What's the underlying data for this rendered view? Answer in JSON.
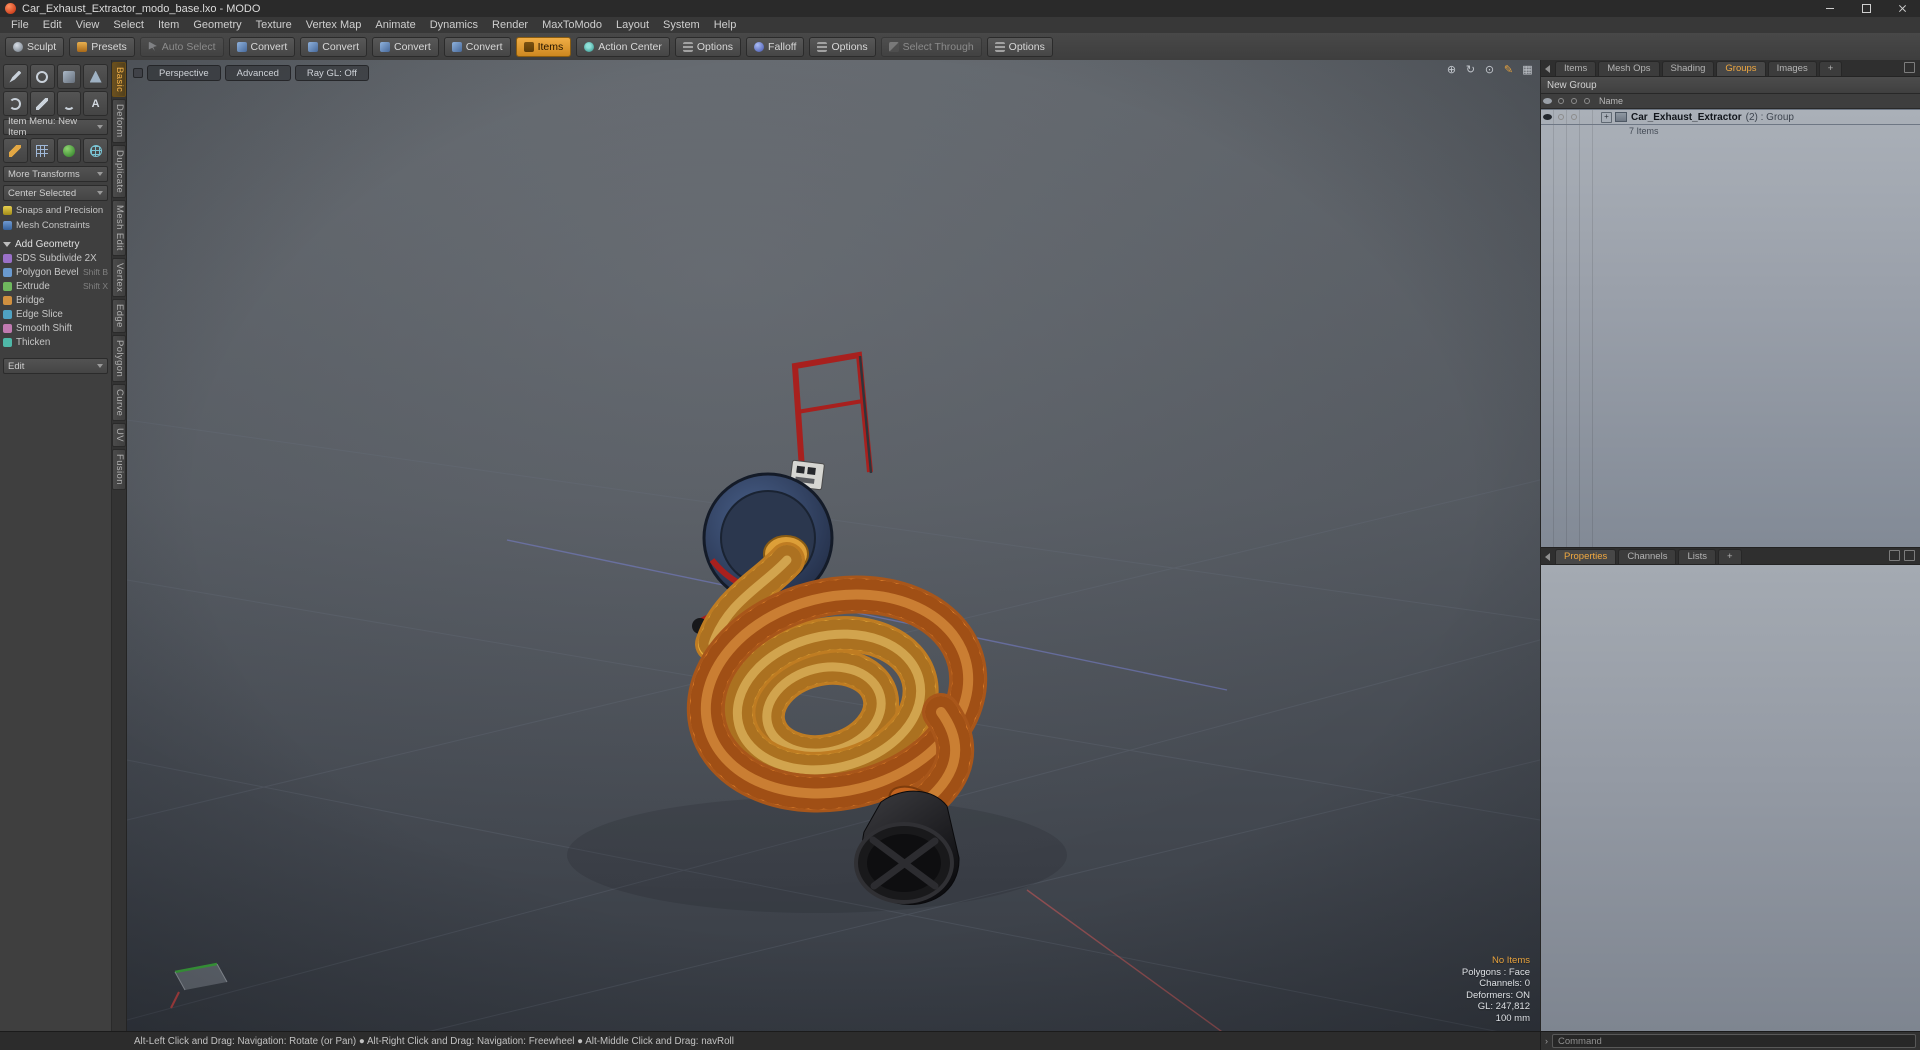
{
  "accent_color": "#e8a33d",
  "window": {
    "title": "Car_Exhaust_Extractor_modo_base.lxo - MODO"
  },
  "menu_bar": {
    "items": [
      "File",
      "Edit",
      "View",
      "Select",
      "Item",
      "Geometry",
      "Texture",
      "Vertex Map",
      "Animate",
      "Dynamics",
      "Render",
      "MaxToModo",
      "Layout",
      "System",
      "Help"
    ]
  },
  "toolbar": {
    "buttons": [
      {
        "label": "Sculpt",
        "icon": "sculpt-icon"
      },
      {
        "label": "Presets",
        "icon": "presets-icon"
      },
      {
        "label": "Auto Select",
        "icon": "auto-select-icon",
        "state": "disabled"
      },
      {
        "label": "Convert",
        "icon": "convert-icon"
      },
      {
        "label": "Convert",
        "icon": "convert-icon"
      },
      {
        "label": "Convert",
        "icon": "convert-icon"
      },
      {
        "label": "Convert",
        "icon": "convert-icon"
      },
      {
        "label": "Items",
        "icon": "items-icon",
        "state": "active"
      },
      {
        "label": "Action Center",
        "icon": "action-center-icon"
      },
      {
        "label": "Options",
        "icon": "options-icon"
      },
      {
        "label": "Falloff",
        "icon": "falloff-icon"
      },
      {
        "label": "Options",
        "icon": "options-icon"
      },
      {
        "label": "Select Through",
        "icon": "select-through-icon",
        "state": "disabled"
      },
      {
        "label": "Options",
        "icon": "options-icon"
      }
    ]
  },
  "left_panel": {
    "item_menu": "Item Menu: New Item",
    "transforms_dropdown": "More Transforms",
    "center_dropdown": "Center Selected",
    "snaps_button": "Snaps and Precision",
    "constraints_button": "Mesh Constraints",
    "section_header": "Add Geometry",
    "text_tool_glyph": "A",
    "tools": [
      {
        "label": "SDS Subdivide 2X",
        "shortcut": "",
        "icon": "sds-subdivide-icon"
      },
      {
        "label": "Polygon Bevel",
        "shortcut": "Shift B",
        "icon": "polygon-bevel-icon"
      },
      {
        "label": "Extrude",
        "shortcut": "Shift X",
        "icon": "extrude-icon"
      },
      {
        "label": "Bridge",
        "shortcut": "",
        "icon": "bridge-icon"
      },
      {
        "label": "Edge Slice",
        "shortcut": "",
        "icon": "edge-slice-icon"
      },
      {
        "label": "Smooth Shift",
        "shortcut": "",
        "icon": "smooth-shift-icon"
      },
      {
        "label": "Thicken",
        "shortcut": "",
        "icon": "thicken-icon"
      }
    ],
    "edit_dropdown": "Edit",
    "vertical_tabs": [
      {
        "label": "Basic",
        "state": "active"
      },
      {
        "label": "Deform"
      },
      {
        "label": "Duplicate"
      },
      {
        "label": "Mesh Edit"
      },
      {
        "label": "Vertex"
      },
      {
        "label": "Edge"
      },
      {
        "label": "Polygon"
      },
      {
        "label": "Curve"
      },
      {
        "label": "UV"
      },
      {
        "label": "Fusion"
      }
    ]
  },
  "viewport": {
    "mode_buttons": [
      {
        "label": "Perspective"
      },
      {
        "label": "Advanced"
      },
      {
        "label": "Ray GL: Off"
      }
    ],
    "tool_icons": [
      {
        "name": "pan-view-icon",
        "glyph": "⊕"
      },
      {
        "name": "rotate-view-icon",
        "glyph": "↻"
      },
      {
        "name": "zoom-view-icon",
        "glyph": "⊙"
      },
      {
        "name": "draw-overlay-icon",
        "glyph": "✎",
        "accent": "accent"
      },
      {
        "name": "grid-toggle-icon",
        "glyph": "▦"
      }
    ],
    "stats": [
      {
        "text": "No Items",
        "emphasis": "highlight"
      },
      {
        "text": "Polygons : Face"
      },
      {
        "text": "Channels: 0"
      },
      {
        "text": "Deformers: ON"
      },
      {
        "text": "GL: 247,812"
      },
      {
        "text": "100 mm"
      }
    ]
  },
  "right_panel": {
    "tabs": [
      {
        "label": "Items"
      },
      {
        "label": "Mesh Ops"
      },
      {
        "label": "Shading"
      },
      {
        "label": "Groups",
        "state": "active"
      },
      {
        "label": "Images"
      },
      {
        "label": "+"
      }
    ],
    "new_group_label": "New Group",
    "name_column": "Name",
    "group_row": {
      "expander": "+",
      "name": "Car_Exhaust_Extractor",
      "meta": "(2) : Group",
      "sub": "7 Items"
    },
    "bottom_tabs": [
      {
        "label": "Properties",
        "state": "active"
      },
      {
        "label": "Channels"
      },
      {
        "label": "Lists"
      },
      {
        "label": "+"
      }
    ]
  },
  "status_bar": {
    "hint": "Alt-Left Click and Drag: Navigation: Rotate (or Pan)   ●   Alt-Right Click and Drag: Navigation: Freewheel   ●   Alt-Middle Click and Drag: navRoll",
    "prompt": "›",
    "command_placeholder": "Command"
  }
}
